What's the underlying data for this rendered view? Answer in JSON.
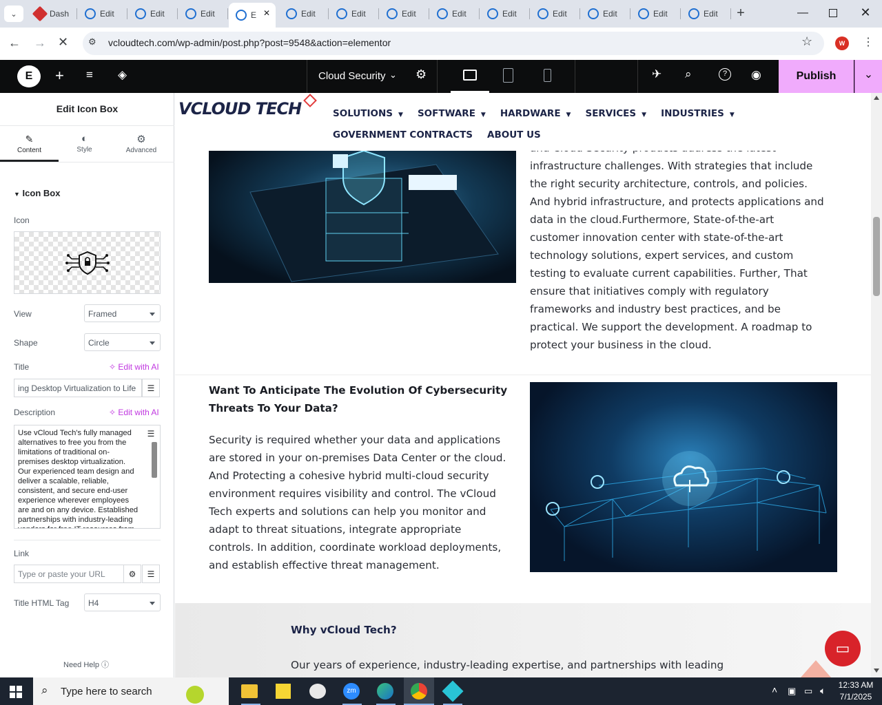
{
  "browser": {
    "tabs": [
      {
        "label": "Dash",
        "color": "#d0302f"
      },
      {
        "label": "Edit"
      },
      {
        "label": "Edit"
      },
      {
        "label": "Edit"
      },
      {
        "label": "E",
        "active": true
      },
      {
        "label": "Edit"
      },
      {
        "label": "Edit"
      },
      {
        "label": "Edit"
      },
      {
        "label": "Edit"
      },
      {
        "label": "Edit"
      },
      {
        "label": "Edit"
      },
      {
        "label": "Edit"
      },
      {
        "label": "Edit"
      },
      {
        "label": "Edit"
      }
    ],
    "url": "vcloudtech.com/wp-admin/post.php?post=9548&action=elementor",
    "profile_initial": "W"
  },
  "editor_top": {
    "page_name": "Cloud Security",
    "publish_label": "Publish"
  },
  "panel": {
    "title": "Edit Icon Box",
    "tabs": {
      "content": "Content",
      "style": "Style",
      "advanced": "Advanced"
    },
    "section": "Icon Box",
    "icon_label": "Icon",
    "view_label": "View",
    "view_value": "Framed",
    "shape_label": "Shape",
    "shape_value": "Circle",
    "title_label": "Title",
    "edit_ai": "Edit with AI",
    "title_value": "ing Desktop Virtualization to Life",
    "description_label": "Description",
    "description_value": "Use vCloud Tech's fully managed alternatives to free you from the limitations of traditional on-premises desktop virtualization. Our experienced team design and deliver a scalable, reliable, consistent, and secure end-user experience wherever employees are and on any device. Established partnerships with industry-leading vendors for free IT resources from",
    "link_label": "Link",
    "link_placeholder": "Type or paste your URL",
    "html_tag_label": "Title HTML Tag",
    "html_tag_value": "H4",
    "need_help": "Need Help"
  },
  "site": {
    "logo_text": "VCLOUD TECH",
    "nav": [
      "SOLUTIONS",
      "SOFTWARE",
      "HARDWARE",
      "SERVICES",
      "INDUSTRIES"
    ],
    "nav2": [
      "GOVERNMENT CONTRACTS",
      "ABOUT US"
    ],
    "top_para_lines": [
      "and Cloud Security products address the latest",
      "infrastructure challenges. With strategies that include",
      "the right security architecture, controls, and policies.",
      "And hybrid infrastructure, and protects applications and",
      "data in the cloud.Furthermore, State-of-the-art",
      "customer innovation center with state-of-the-art",
      "technology solutions, expert services, and custom",
      "testing to evaluate current capabilities. Further, That",
      "ensure that initiatives comply with regulatory",
      "frameworks and industry best practices, and be",
      "practical. We support the development. A roadmap to",
      "protect your business in the cloud."
    ],
    "section2_heading_lines": [
      "Want To Anticipate The Evolution Of Cybersecurity",
      "Threats To Your Data?"
    ],
    "section2_para_lines": [
      "Security is required whether your data and applications",
      "are stored in your on-premises Data Center or the cloud.",
      "And Protecting a cohesive hybrid multi-cloud security",
      "environment requires visibility and control. The vCloud",
      "Tech experts and solutions can help you monitor and",
      "adapt to threat situations, integrate appropriate",
      "controls. In addition, coordinate workload deployments,",
      "and establish effective threat management."
    ],
    "why_heading": "Why vCloud Tech?",
    "why_para": "Our years of experience, industry-leading expertise, and partnerships with leading"
  },
  "taskbar": {
    "search_placeholder": "Type here to search",
    "time": "12:33 AM",
    "date": "7/1/2025"
  }
}
